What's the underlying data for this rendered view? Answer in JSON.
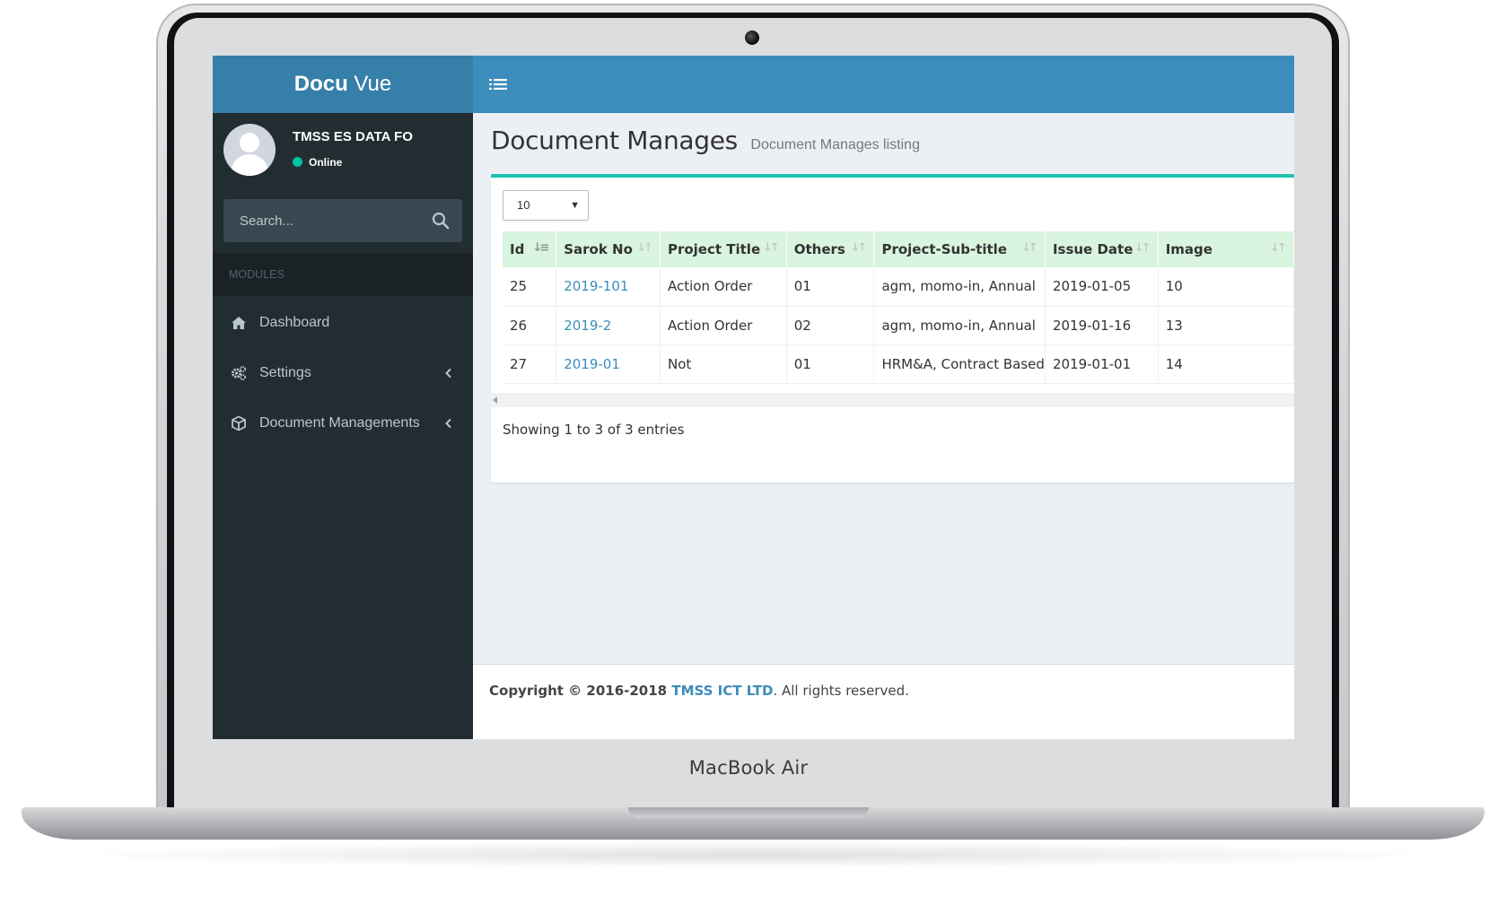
{
  "device": {
    "label": "MacBook Air"
  },
  "app": {
    "logo_bold": "Docu",
    "logo_light": " Vue"
  },
  "user": {
    "name": "TMSS ES DATA FO",
    "status": "Online"
  },
  "sidebar": {
    "search_placeholder": "Search...",
    "section_header": "MODULES",
    "items": [
      {
        "label": "Dashboard",
        "icon": "home-icon",
        "has_children": false
      },
      {
        "label": "Settings",
        "icon": "gears-icon",
        "has_children": true
      },
      {
        "label": "Document Managements",
        "icon": "cube-icon",
        "has_children": true
      }
    ]
  },
  "page": {
    "title": "Document Manages",
    "subtitle": "Document Manages listing"
  },
  "table": {
    "page_length": "10",
    "columns": [
      "Id",
      "Sarok No",
      "Project Title",
      "Others",
      "Project-Sub-title",
      "Issue Date",
      "Image"
    ],
    "rows": [
      {
        "id": "25",
        "sarok_no": "2019-101",
        "project_title": "Action Order",
        "others": "01",
        "sub_title": "agm, momo-in, Annual",
        "issue_date": "2019-01-05",
        "image": "10"
      },
      {
        "id": "26",
        "sarok_no": "2019-2",
        "project_title": "Action Order",
        "others": "02",
        "sub_title": "agm, momo-in, Annual",
        "issue_date": "2019-01-16",
        "image": "13"
      },
      {
        "id": "27",
        "sarok_no": "2019-01",
        "project_title": "Not",
        "others": "01",
        "sub_title": "HRM&A, Contract Based",
        "issue_date": "2019-01-01",
        "image": "14"
      }
    ],
    "info": "Showing 1 to 3 of 3 entries"
  },
  "footer": {
    "copyright": "Copyright © 2016-2018 ",
    "company": "TMSS ICT LTD",
    "rights": ". All rights reserved."
  },
  "colors": {
    "header": "#3c8dbc",
    "logo_bg": "#367fa9",
    "sidebar": "#222d32",
    "box_accent": "#20c2b0",
    "table_header": "#d9f5df",
    "link": "#3c8dbc"
  }
}
